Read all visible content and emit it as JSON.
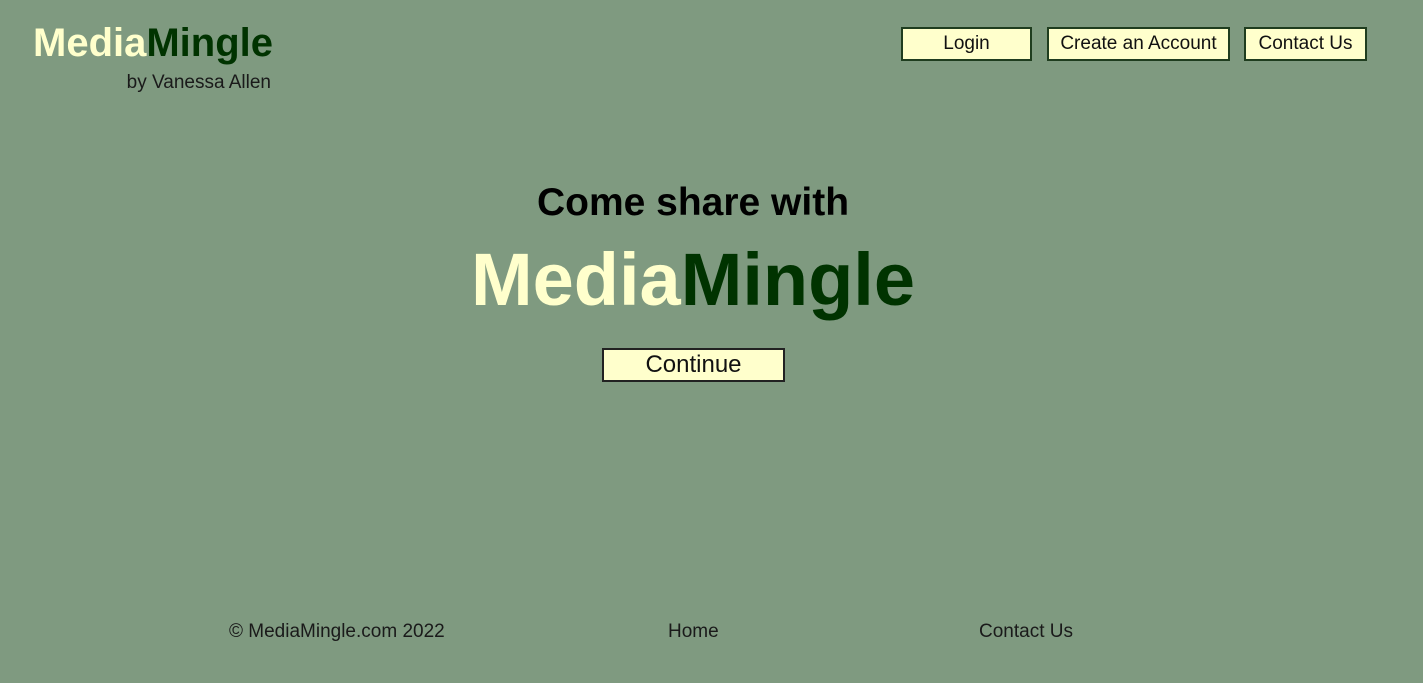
{
  "brand": {
    "part1": "Media",
    "part2": "Mingle",
    "byline": "by Vanessa Allen"
  },
  "nav": {
    "login": "Login",
    "create_account": "Create an Account",
    "contact": "Contact Us"
  },
  "hero": {
    "tagline": "Come share with",
    "title_part1": "Media",
    "title_part2": "Mingle",
    "continue_label": "Continue"
  },
  "footer": {
    "copyright": "© MediaMingle.com 2022",
    "home": "Home",
    "contact": "Contact Us"
  },
  "colors": {
    "background": "#7f9a80",
    "brand_light": "#ffffcc",
    "brand_dark": "#003300",
    "button_bg": "#ffffcc"
  }
}
